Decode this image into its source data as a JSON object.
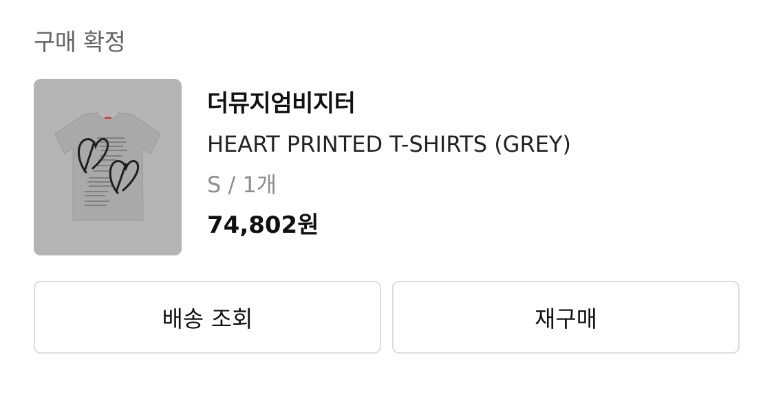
{
  "header": {
    "status_label": "구매 확정"
  },
  "product": {
    "brand": "더뮤지엄비지터",
    "name": "HEART PRINTED T-SHIRTS (GREY)",
    "option": "S / 1개",
    "price": "74,802원",
    "image_description_icon": "grey-t-shirt-heart-print-image"
  },
  "actions": {
    "track_delivery_label": "배송 조회",
    "rebuy_label": "재구매"
  },
  "colors": {
    "background": "#ffffff",
    "heading_text": "#666666",
    "primary_text": "#111111",
    "secondary_text": "#8e8e8e",
    "button_border": "#dcdcdc",
    "image_background": "#b4b4b4"
  }
}
